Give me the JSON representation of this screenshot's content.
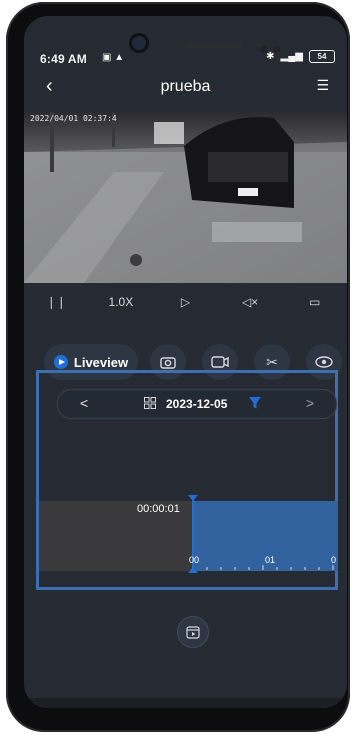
{
  "status_bar": {
    "time": "6:49 AM",
    "battery": "54"
  },
  "header": {
    "back_icon": "chevron-left-icon",
    "title": "prueba",
    "menu_icon": "list-menu-icon"
  },
  "video": {
    "timestamp": "2022/04/01 02:37:4"
  },
  "video_controls": {
    "pause_icon": "pause-icon",
    "speed": "1.0X",
    "play_icon": "play-icon",
    "mute_icon": "mute-icon",
    "rotate_icon": "rotate-icon"
  },
  "actions": {
    "liveview_label": "Liveview",
    "snapshot_icon": "camera-icon",
    "record_icon": "video-record-icon",
    "clip_icon": "scissors-icon",
    "eye_icon": "eye-icon"
  },
  "timeline": {
    "prev_label": "<",
    "next_label": ">",
    "date": "2023-12-05",
    "cursor_time": "00:00:01",
    "scale_labels": [
      "00",
      "01",
      "0"
    ]
  },
  "colors": {
    "accent": "#1f6fd6",
    "timeline_fill": "#33639f",
    "frame_border": "#3c6fb2"
  }
}
